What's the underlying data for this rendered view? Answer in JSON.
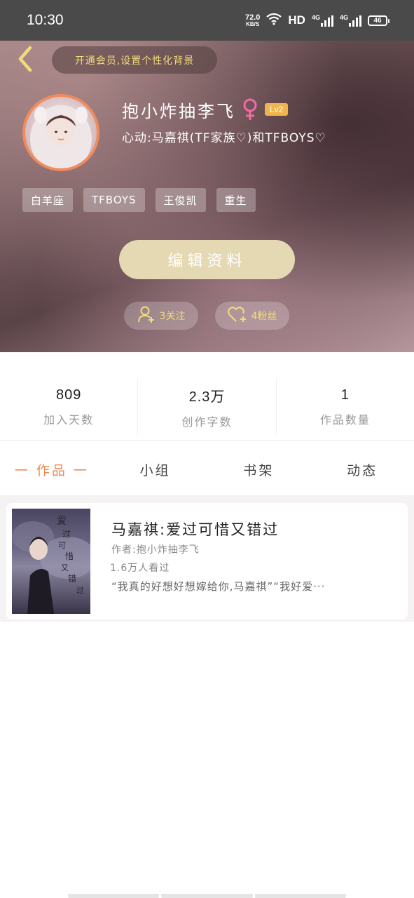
{
  "status_bar": {
    "time": "10:30",
    "speed_value": "72.0",
    "speed_unit": "KB/S",
    "hd": "HD",
    "net1": "4G",
    "net2": "4G",
    "battery": "46",
    "icons": [
      "wifi-icon",
      "signal-icon",
      "battery-icon"
    ]
  },
  "header": {
    "back_icon": "chevron-left-icon",
    "vip_banner": "开通会员,设置个性化背景"
  },
  "profile": {
    "username": "抱小炸抽李飞",
    "gender_icon": "female-icon",
    "level": "Lv2",
    "signature": "心动:马嘉祺(TF家族♡)和TFBOYS♡",
    "tags": [
      "白羊座",
      "TFBOYS",
      "王俊凯",
      "重生"
    ],
    "edit_button": "编辑资料",
    "following": "3关注",
    "followers": "4粉丝"
  },
  "stats": [
    {
      "value": "809",
      "label": "加入天数"
    },
    {
      "value": "2.3万",
      "label": "创作字数"
    },
    {
      "value": "1",
      "label": "作品数量"
    }
  ],
  "tabs": [
    "一 作品 一",
    "小组",
    "书架",
    "动态"
  ],
  "works": [
    {
      "title": "马嘉祺:爱过可惜又错过",
      "author": "作者:抱小炸抽李飞",
      "views": "1.6万人看过",
      "excerpt": "“我真的好想好想嫁给你,马嘉祺”“我好爱···",
      "cover_text": "爱过可惜又错过"
    }
  ],
  "colors": {
    "accent": "#ec8a55",
    "gold": "#f1dc7a",
    "edit_button_bg": "#e5d9b3",
    "avatar_border": "#f08b5d",
    "level_badge": "#f0b54a"
  }
}
